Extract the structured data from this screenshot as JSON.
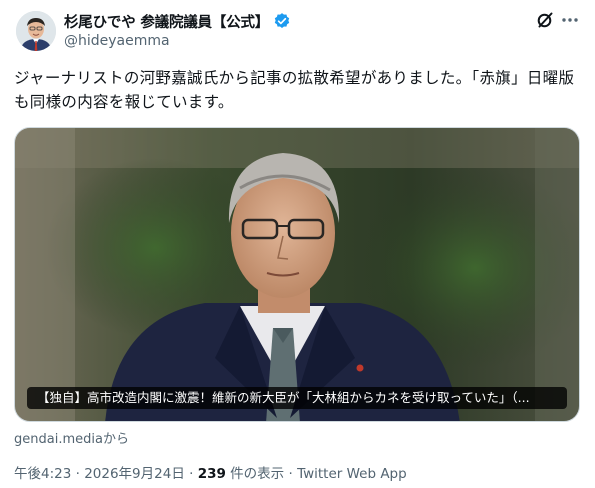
{
  "author": {
    "display_name": "杉尾ひでや 参議院議員【公式】",
    "handle": "@hideyaemma",
    "verified_icon": "verified-badge-icon",
    "avatar_icon": "profile-photo"
  },
  "header_actions": {
    "grok_icon": "grok-icon",
    "more_icon": "more-options-icon"
  },
  "tweet": {
    "text": "ジャーナリストの河野嘉誠氏から記事の拡散希望がありました。「赤旗」日曜版も同様の内容を報じています。"
  },
  "media": {
    "caption": "【独自】高市改造内閣に激震！維新の新大臣が「大林組からカネを受け取っていた」（...",
    "source": "gendai.mediaから"
  },
  "meta": {
    "time": "午後4:23",
    "sep1": " · ",
    "date": "2026年9月24日",
    "sep2": " · ",
    "views_count": "239",
    "views_label": " 件の表示",
    "sep3": " · ",
    "client": "Twitter Web App"
  },
  "colors": {
    "verified_blue": "#1d9bf0",
    "secondary_text": "#536471",
    "primary_text": "#0f1419"
  }
}
